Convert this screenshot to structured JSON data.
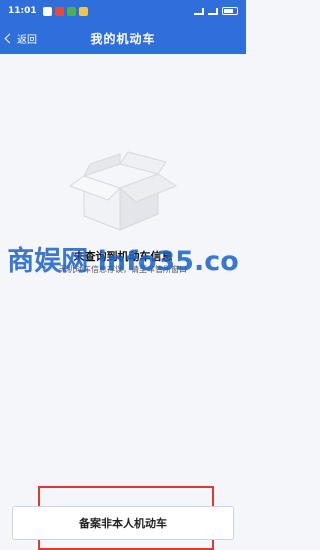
{
  "status_bar": {
    "time": "11:01",
    "right_text": "..",
    "app_colors": [
      "#ffffff",
      "#e9483b",
      "#4caf50",
      "#f5c542"
    ]
  },
  "nav": {
    "back_label": "返回",
    "title": "我的机动车"
  },
  "empty_state": {
    "title": "未查询到机动车信息",
    "subtitle": "无机动车信息存误，请至车管所窗口"
  },
  "watermark": "商娱网 info35.co",
  "actions": {
    "register_non_owner_vehicle": "备案非本人机动车"
  },
  "colors": {
    "primary": "#2f6fdc",
    "highlight": "#e03a2f",
    "watermark": "#1a63c9"
  }
}
